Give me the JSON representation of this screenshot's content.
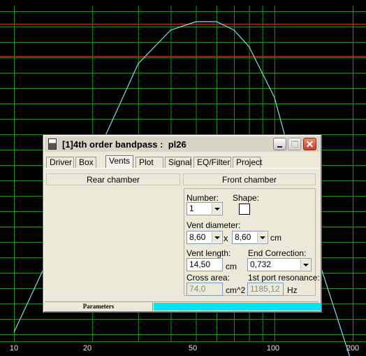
{
  "plot": {
    "x_ticks": [
      "10",
      "20",
      "50",
      "100",
      "200"
    ],
    "colors": {
      "background": "#000000",
      "grid": "#1f8f1f",
      "ref_line": "#c0303c",
      "curve": "#7fe0e6"
    }
  },
  "chart_data": {
    "type": "line",
    "x_ticks": [
      "10",
      "20",
      "50",
      "100",
      "200"
    ],
    "x": [
      10,
      20,
      30,
      40,
      50,
      60,
      70,
      80,
      100,
      150,
      200
    ],
    "values": [
      -18,
      -8,
      -2,
      0,
      0.5,
      0.5,
      0,
      -1,
      -4,
      -14,
      -20
    ]
  },
  "window": {
    "title": "[1]4th order bandpass :  pl26",
    "tabs": [
      "Driver",
      "Box",
      "Vents",
      "Plot",
      "Signal",
      "EQ/Filter",
      "Project"
    ],
    "active_tab": "Vents",
    "rear_chamber": "Rear chamber",
    "front_chamber": "Front chamber",
    "number_label": "Number:",
    "number_value": "1",
    "shape_label": "Shape:",
    "vent_diameter_label": "Vent diameter:",
    "diameter1": "8,60",
    "times_symbol": "x",
    "diameter2": "8,60",
    "unit_cm": "cm",
    "vent_length_label": "Vent length:",
    "vent_length_value": "14,50",
    "end_correction_label": "End Correction:",
    "end_correction_value": "0,732",
    "cross_area_label": "Cross area:",
    "cross_area_value": "74,0",
    "unit_cm2": "cm^2",
    "port_res_label": "1st port resonance:",
    "port_res_value": "1185,12",
    "unit_hz": "Hz",
    "status_text": "Parameters"
  }
}
